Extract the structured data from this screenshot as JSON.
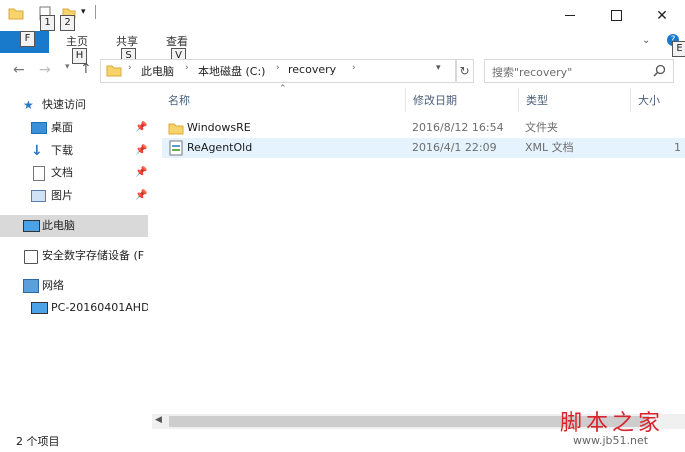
{
  "quick_access_toolbar": {
    "keytips": [
      "1",
      "2"
    ]
  },
  "ribbon": {
    "file_tab": {
      "label": "",
      "keytip": "F"
    },
    "tabs": [
      {
        "label": "主页",
        "keytip": "H"
      },
      {
        "label": "共享",
        "keytip": "S"
      },
      {
        "label": "查看",
        "keytip": "V"
      }
    ],
    "help_keytip": "E"
  },
  "address_bar": {
    "breadcrumbs": [
      "此电脑",
      "本地磁盘 (C:)",
      "recovery"
    ]
  },
  "search": {
    "placeholder": "搜索\"recovery\""
  },
  "sidebar": {
    "quick_access_label": "快速访问",
    "pinned": [
      {
        "label": "桌面",
        "icon": "desktop-icon"
      },
      {
        "label": "下载",
        "icon": "download-icon"
      },
      {
        "label": "文档",
        "icon": "document-icon"
      },
      {
        "label": "图片",
        "icon": "picture-icon"
      }
    ],
    "this_pc": "此电脑",
    "secure_storage": "安全数字存储设备 (F",
    "network": "网络",
    "network_pc": "PC-20160401AHD"
  },
  "file_list": {
    "columns": [
      "名称",
      "修改日期",
      "类型",
      "大小"
    ],
    "rows": [
      {
        "name": "WindowsRE",
        "date": "2016/8/12 16:54",
        "type": "文件夹",
        "size": "",
        "icon": "folder-icon"
      },
      {
        "name": "ReAgentOld",
        "date": "2016/4/1 22:09",
        "type": "XML 文档",
        "size": "1",
        "icon": "xml-file-icon"
      }
    ]
  },
  "status_bar": {
    "item_count": "2 个项目"
  },
  "watermark": {
    "brand": "脚本之家",
    "url": "www.jb51.net"
  },
  "colors": {
    "accent": "#1979ca",
    "selected_row": "#e5f3ff"
  }
}
